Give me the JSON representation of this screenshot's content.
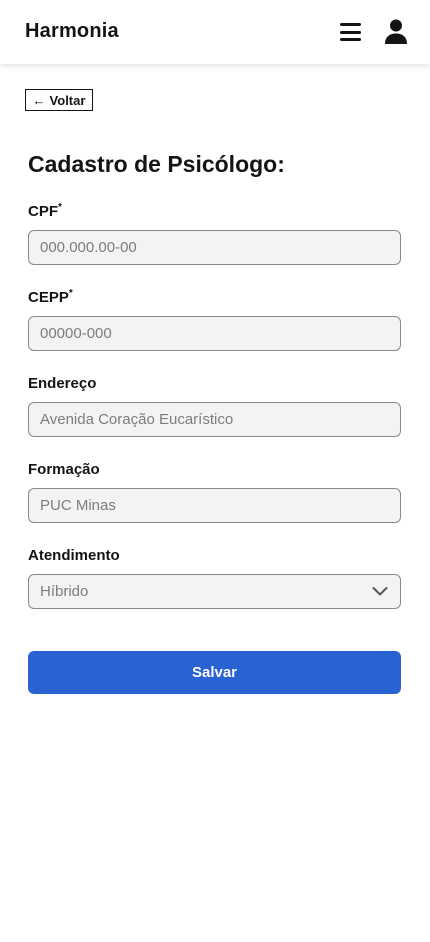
{
  "header": {
    "brand": "Harmonia",
    "menu_icon": "hamburger-menu-icon",
    "user_icon": "user-icon"
  },
  "back_button": {
    "icon": "arrow-left-icon",
    "arrow": "←",
    "label": "Voltar"
  },
  "page": {
    "title": "Cadastro de Psicólogo:"
  },
  "form": {
    "cpf": {
      "label": "CPF",
      "required_mark": "*",
      "placeholder": "000.000.00-00",
      "value": ""
    },
    "cepp": {
      "label": "CEPP",
      "required_mark": "*",
      "placeholder": "00000-000",
      "value": ""
    },
    "endereco": {
      "label": "Endereço",
      "placeholder": "Avenida Coração Eucarístico",
      "value": ""
    },
    "formacao": {
      "label": "Formação",
      "placeholder": "PUC Minas",
      "value": ""
    },
    "atendimento": {
      "label": "Atendimento",
      "selected": "Híbrido",
      "icon": "chevron-down-icon"
    },
    "save_label": "Salvar"
  },
  "colors": {
    "primary": "#2962d2",
    "text": "#141414",
    "input_bg": "#f3f3f3",
    "input_border": "#8a8a8a",
    "placeholder": "#7d7d7d"
  }
}
